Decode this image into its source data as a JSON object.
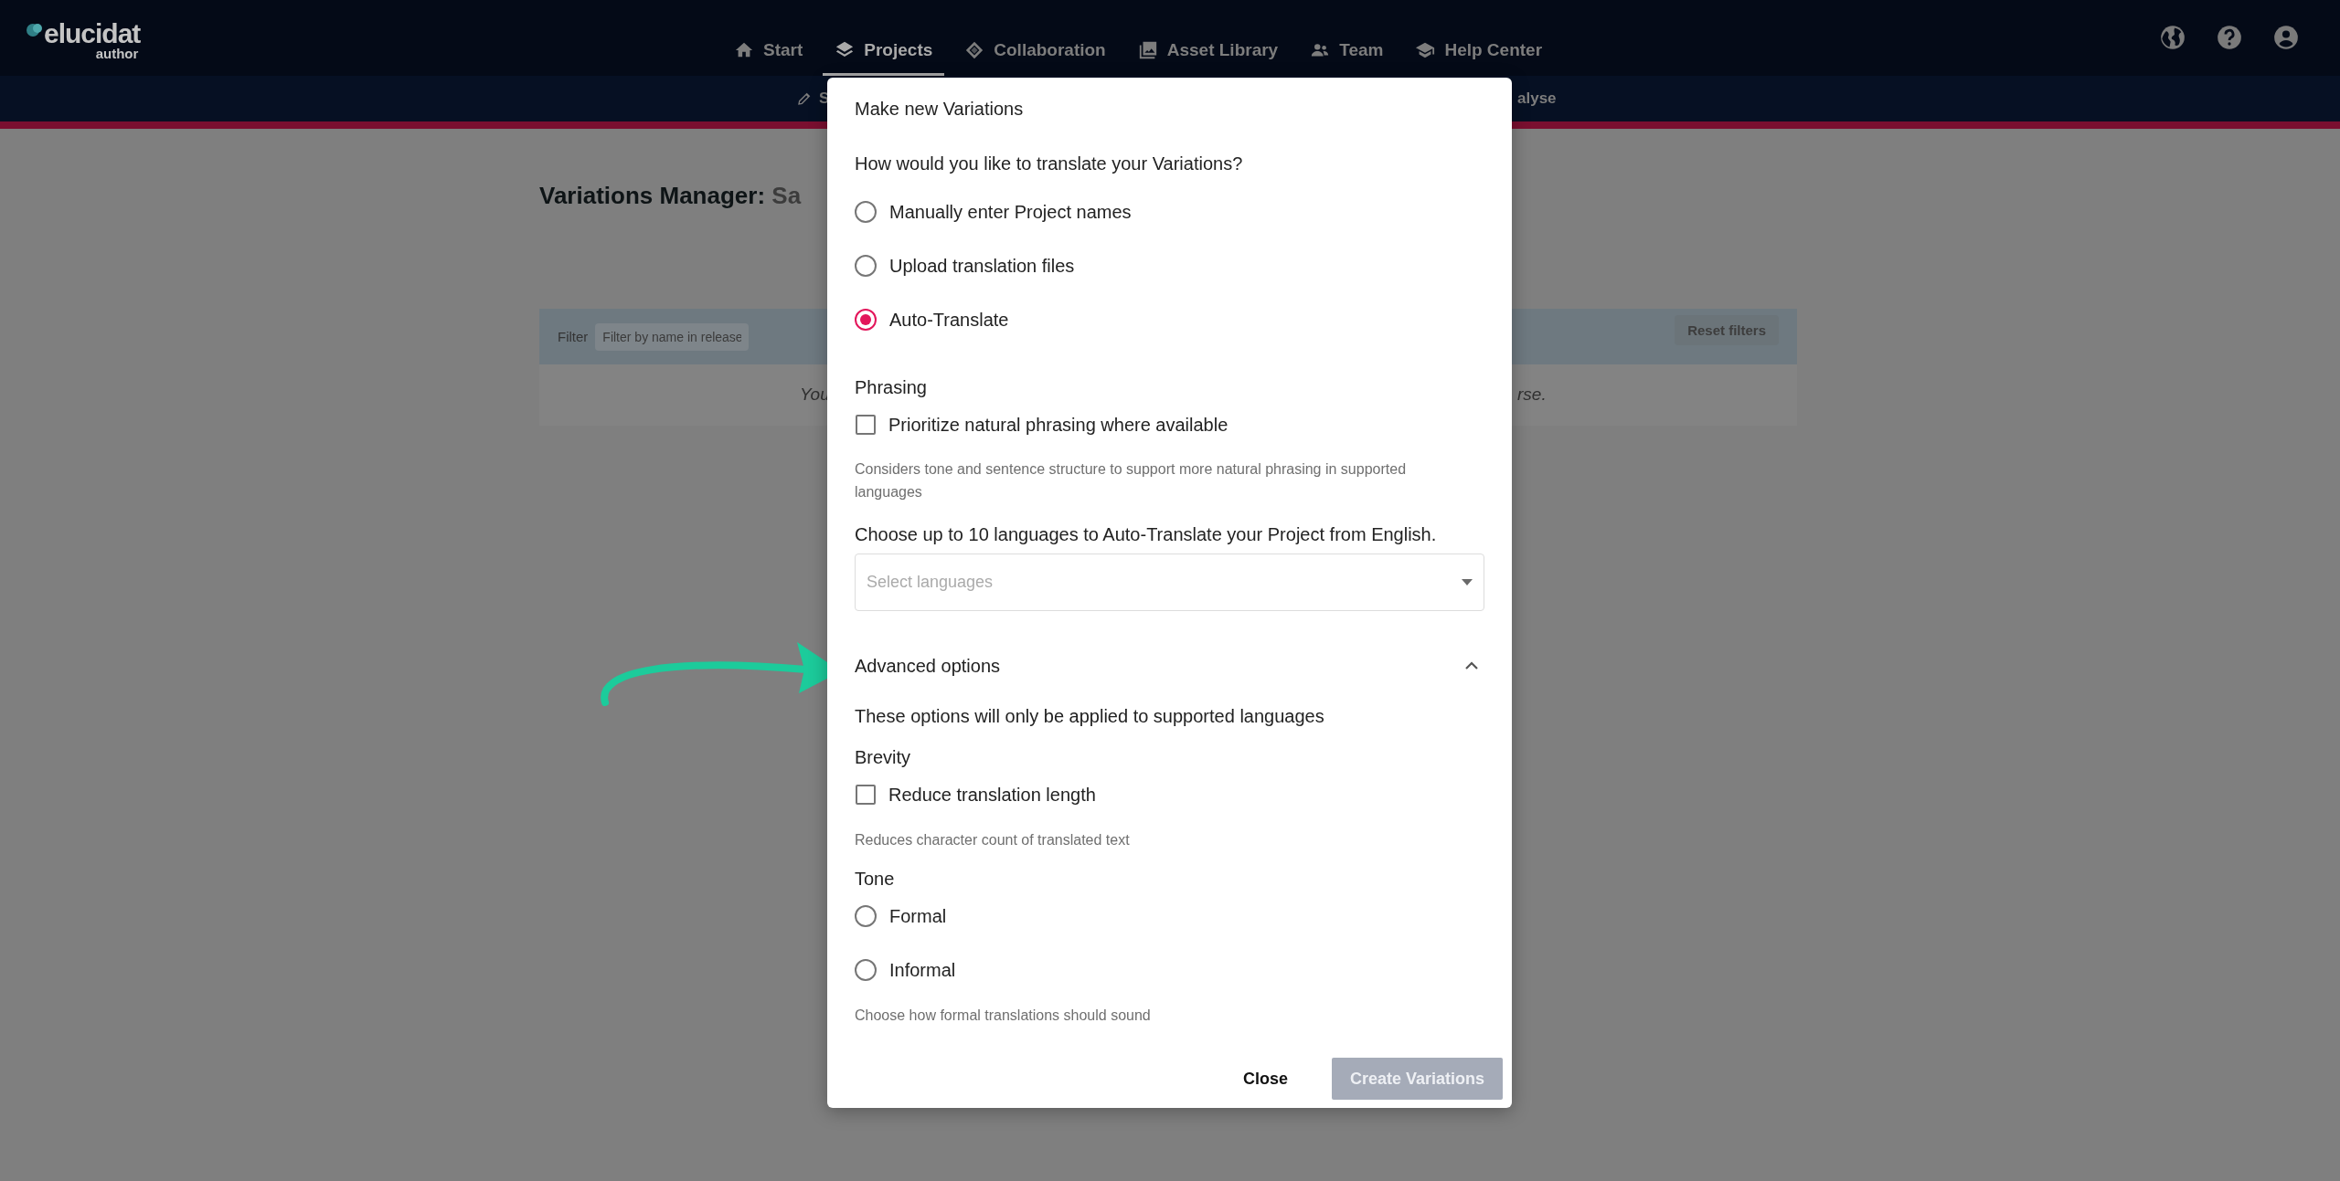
{
  "header": {
    "logo": {
      "name": "elucidat",
      "sub": "author"
    },
    "nav": [
      {
        "label": "Start",
        "selected": false
      },
      {
        "label": "Projects",
        "selected": true
      },
      {
        "label": "Collaboration",
        "selected": false
      },
      {
        "label": "Asset Library",
        "selected": false
      },
      {
        "label": "Team",
        "selected": false
      },
      {
        "label": "Help Center",
        "selected": false
      }
    ]
  },
  "subnav": {
    "left": "S",
    "right": "alyse"
  },
  "page": {
    "title": "Variations Manager:",
    "title_name": "Sa",
    "filter_label": "Filter",
    "filter_placeholder": "Filter by name in release",
    "reset_button": "Reset filters",
    "empty_start": "You",
    "empty_end": "rse."
  },
  "modal": {
    "title": "Make new Variations",
    "question": "How would you like to translate your Variations?",
    "modes": [
      {
        "label": "Manually enter Project names",
        "selected": false
      },
      {
        "label": "Upload translation files",
        "selected": false
      },
      {
        "label": "Auto-Translate",
        "selected": true
      }
    ],
    "phrasing": {
      "heading": "Phrasing",
      "option": {
        "label": "Prioritize natural phrasing where available",
        "checked": false
      },
      "hint": "Considers tone and sentence structure to support more natural phrasing in supported languages"
    },
    "languages": {
      "label": "Choose up to 10 languages to Auto-Translate your Project from English.",
      "placeholder": "Select languages"
    },
    "advanced": {
      "label": "Advanced options",
      "expanded": true,
      "note": "These options will only be applied to supported languages",
      "brevity": {
        "heading": "Brevity",
        "option": {
          "label": "Reduce translation length",
          "checked": false
        },
        "hint": "Reduces character count of translated text"
      },
      "tone": {
        "heading": "Tone",
        "options": [
          {
            "label": "Formal",
            "selected": false
          },
          {
            "label": "Informal",
            "selected": false
          }
        ],
        "hint": "Choose how formal translations should sound"
      }
    },
    "buttons": [
      {
        "label": "Close",
        "kind": "text",
        "disabled": false
      },
      {
        "label": "Create Variations",
        "kind": "primary",
        "disabled": true
      }
    ]
  }
}
